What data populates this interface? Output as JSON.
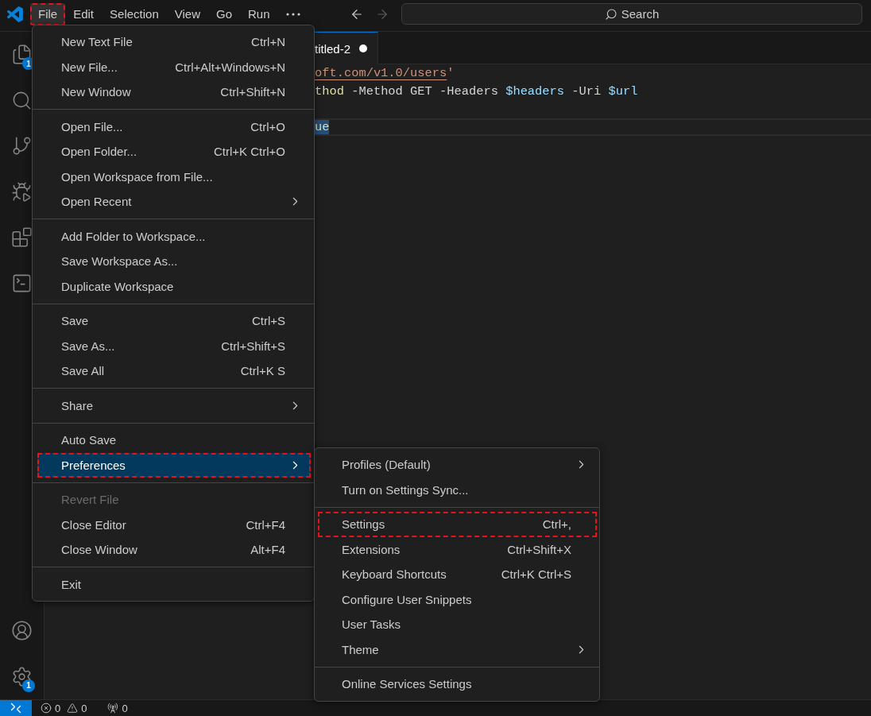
{
  "title_bar": {
    "menu": [
      {
        "label": "File",
        "selected": true,
        "marked": true
      },
      {
        "label": "Edit",
        "selected": false,
        "marked": false
      },
      {
        "label": "Selection",
        "selected": false,
        "marked": false
      },
      {
        "label": "View",
        "selected": false,
        "marked": false
      },
      {
        "label": "Go",
        "selected": false,
        "marked": false
      },
      {
        "label": "Run",
        "selected": false,
        "marked": false
      }
    ],
    "navigation": [
      {
        "kind": "back",
        "disabled": false
      },
      {
        "kind": "forward",
        "disabled": true
      }
    ],
    "search": {
      "label": "Search"
    }
  },
  "activity_bar": {
    "top": [
      {
        "kind": "explorer",
        "badge": "1"
      },
      {
        "kind": "search"
      },
      {
        "kind": "source_control"
      },
      {
        "kind": "run_debug"
      },
      {
        "kind": "extensions"
      },
      {
        "kind": "terminal"
      }
    ],
    "bottom": [
      {
        "kind": "accounts"
      },
      {
        "kind": "manage",
        "badge": "1"
      }
    ]
  },
  "editor": {
    "tabs": [
      {
        "label": "titled-2",
        "selected": true,
        "modified": true
      }
    ],
    "lines": [
      {
        "kind": "code",
        "current": false,
        "segments": [
          {
            "text": "oft.com/v1.0/users",
            "kind": "string",
            "selected": false,
            "underlined": true
          },
          {
            "text": "'",
            "kind": "string",
            "selected": false,
            "underlined": false
          }
        ]
      },
      {
        "kind": "code",
        "current": false,
        "segments": [
          {
            "text": "thod",
            "kind": "command",
            "selected": false,
            "underlined": false
          },
          {
            "text": " -Method GET -Headers ",
            "kind": "plain",
            "selected": false,
            "underlined": false
          },
          {
            "text": "$headers",
            "kind": "variable",
            "selected": false,
            "underlined": false
          },
          {
            "text": " -Uri ",
            "kind": "plain",
            "selected": false,
            "underlined": false
          },
          {
            "text": "$url",
            "kind": "variable",
            "selected": false,
            "underlined": false
          }
        ]
      },
      {
        "kind": "blank",
        "current": false
      },
      {
        "kind": "code",
        "current": true,
        "segments": [
          {
            "text": "ue",
            "kind": "member",
            "selected": true,
            "underlined": false
          }
        ]
      }
    ]
  },
  "file_menu": {
    "groups": [
      {
        "items": [
          {
            "label": "New Text File",
            "shortcut": "Ctrl+N",
            "submenu": false,
            "disabled": false,
            "selected": false,
            "marked": false
          },
          {
            "label": "New File...",
            "shortcut": "Ctrl+Alt+Windows+N",
            "submenu": false,
            "disabled": false,
            "selected": false,
            "marked": false
          },
          {
            "label": "New Window",
            "shortcut": "Ctrl+Shift+N",
            "submenu": false,
            "disabled": false,
            "selected": false,
            "marked": false
          }
        ]
      },
      {
        "items": [
          {
            "label": "Open File...",
            "shortcut": "Ctrl+O",
            "submenu": false,
            "disabled": false,
            "selected": false,
            "marked": false
          },
          {
            "label": "Open Folder...",
            "shortcut": "Ctrl+K Ctrl+O",
            "submenu": false,
            "disabled": false,
            "selected": false,
            "marked": false
          },
          {
            "label": "Open Workspace from File...",
            "submenu": false,
            "disabled": false,
            "selected": false,
            "marked": false
          },
          {
            "label": "Open Recent",
            "submenu": true,
            "disabled": false,
            "selected": false,
            "marked": false
          }
        ]
      },
      {
        "items": [
          {
            "label": "Add Folder to Workspace...",
            "submenu": false,
            "disabled": false,
            "selected": false,
            "marked": false
          },
          {
            "label": "Save Workspace As...",
            "submenu": false,
            "disabled": false,
            "selected": false,
            "marked": false
          },
          {
            "label": "Duplicate Workspace",
            "submenu": false,
            "disabled": false,
            "selected": false,
            "marked": false
          }
        ]
      },
      {
        "items": [
          {
            "label": "Save",
            "shortcut": "Ctrl+S",
            "submenu": false,
            "disabled": false,
            "selected": false,
            "marked": false
          },
          {
            "label": "Save As...",
            "shortcut": "Ctrl+Shift+S",
            "submenu": false,
            "disabled": false,
            "selected": false,
            "marked": false
          },
          {
            "label": "Save All",
            "shortcut": "Ctrl+K S",
            "submenu": false,
            "disabled": false,
            "selected": false,
            "marked": false
          }
        ]
      },
      {
        "items": [
          {
            "label": "Share",
            "submenu": true,
            "disabled": false,
            "selected": false,
            "marked": false
          }
        ]
      },
      {
        "items": [
          {
            "label": "Auto Save",
            "submenu": false,
            "disabled": false,
            "selected": false,
            "marked": false
          },
          {
            "label": "Preferences",
            "submenu": true,
            "disabled": false,
            "selected": true,
            "marked": true
          }
        ]
      },
      {
        "items": [
          {
            "label": "Revert File",
            "submenu": false,
            "disabled": true,
            "selected": false,
            "marked": false
          },
          {
            "label": "Close Editor",
            "shortcut": "Ctrl+F4",
            "submenu": false,
            "disabled": false,
            "selected": false,
            "marked": false
          },
          {
            "label": "Close Window",
            "shortcut": "Alt+F4",
            "submenu": false,
            "disabled": false,
            "selected": false,
            "marked": false
          }
        ]
      },
      {
        "items": [
          {
            "label": "Exit",
            "submenu": false,
            "disabled": false,
            "selected": false,
            "marked": false
          }
        ]
      }
    ]
  },
  "preferences_submenu": {
    "groups": [
      {
        "items": [
          {
            "label": "Profiles (Default)",
            "submenu": true,
            "disabled": false,
            "selected": false,
            "marked": false
          },
          {
            "label": "Turn on Settings Sync...",
            "submenu": false,
            "disabled": false,
            "selected": false,
            "marked": false
          }
        ]
      },
      {
        "items": [
          {
            "label": "Settings",
            "shortcut": "Ctrl+,",
            "submenu": false,
            "disabled": false,
            "selected": false,
            "marked": true
          },
          {
            "label": "Extensions",
            "shortcut": "Ctrl+Shift+X",
            "submenu": false,
            "disabled": false,
            "selected": false,
            "marked": false
          },
          {
            "label": "Keyboard Shortcuts",
            "shortcut": "Ctrl+K Ctrl+S",
            "submenu": false,
            "disabled": false,
            "selected": false,
            "marked": false
          },
          {
            "label": "Configure User Snippets",
            "submenu": false,
            "disabled": false,
            "selected": false,
            "marked": false
          },
          {
            "label": "User Tasks",
            "submenu": false,
            "disabled": false,
            "selected": false,
            "marked": false
          },
          {
            "label": "Theme",
            "submenu": true,
            "disabled": false,
            "selected": false,
            "marked": false
          }
        ]
      },
      {
        "items": [
          {
            "label": "Online Services Settings",
            "submenu": false,
            "disabled": false,
            "selected": false,
            "marked": false
          }
        ]
      }
    ]
  },
  "status_bar": {
    "items": [
      {
        "kind": "errors",
        "label": "0"
      },
      {
        "kind": "warnings",
        "label": "0"
      },
      {
        "kind": "ports",
        "label": "0"
      }
    ]
  }
}
